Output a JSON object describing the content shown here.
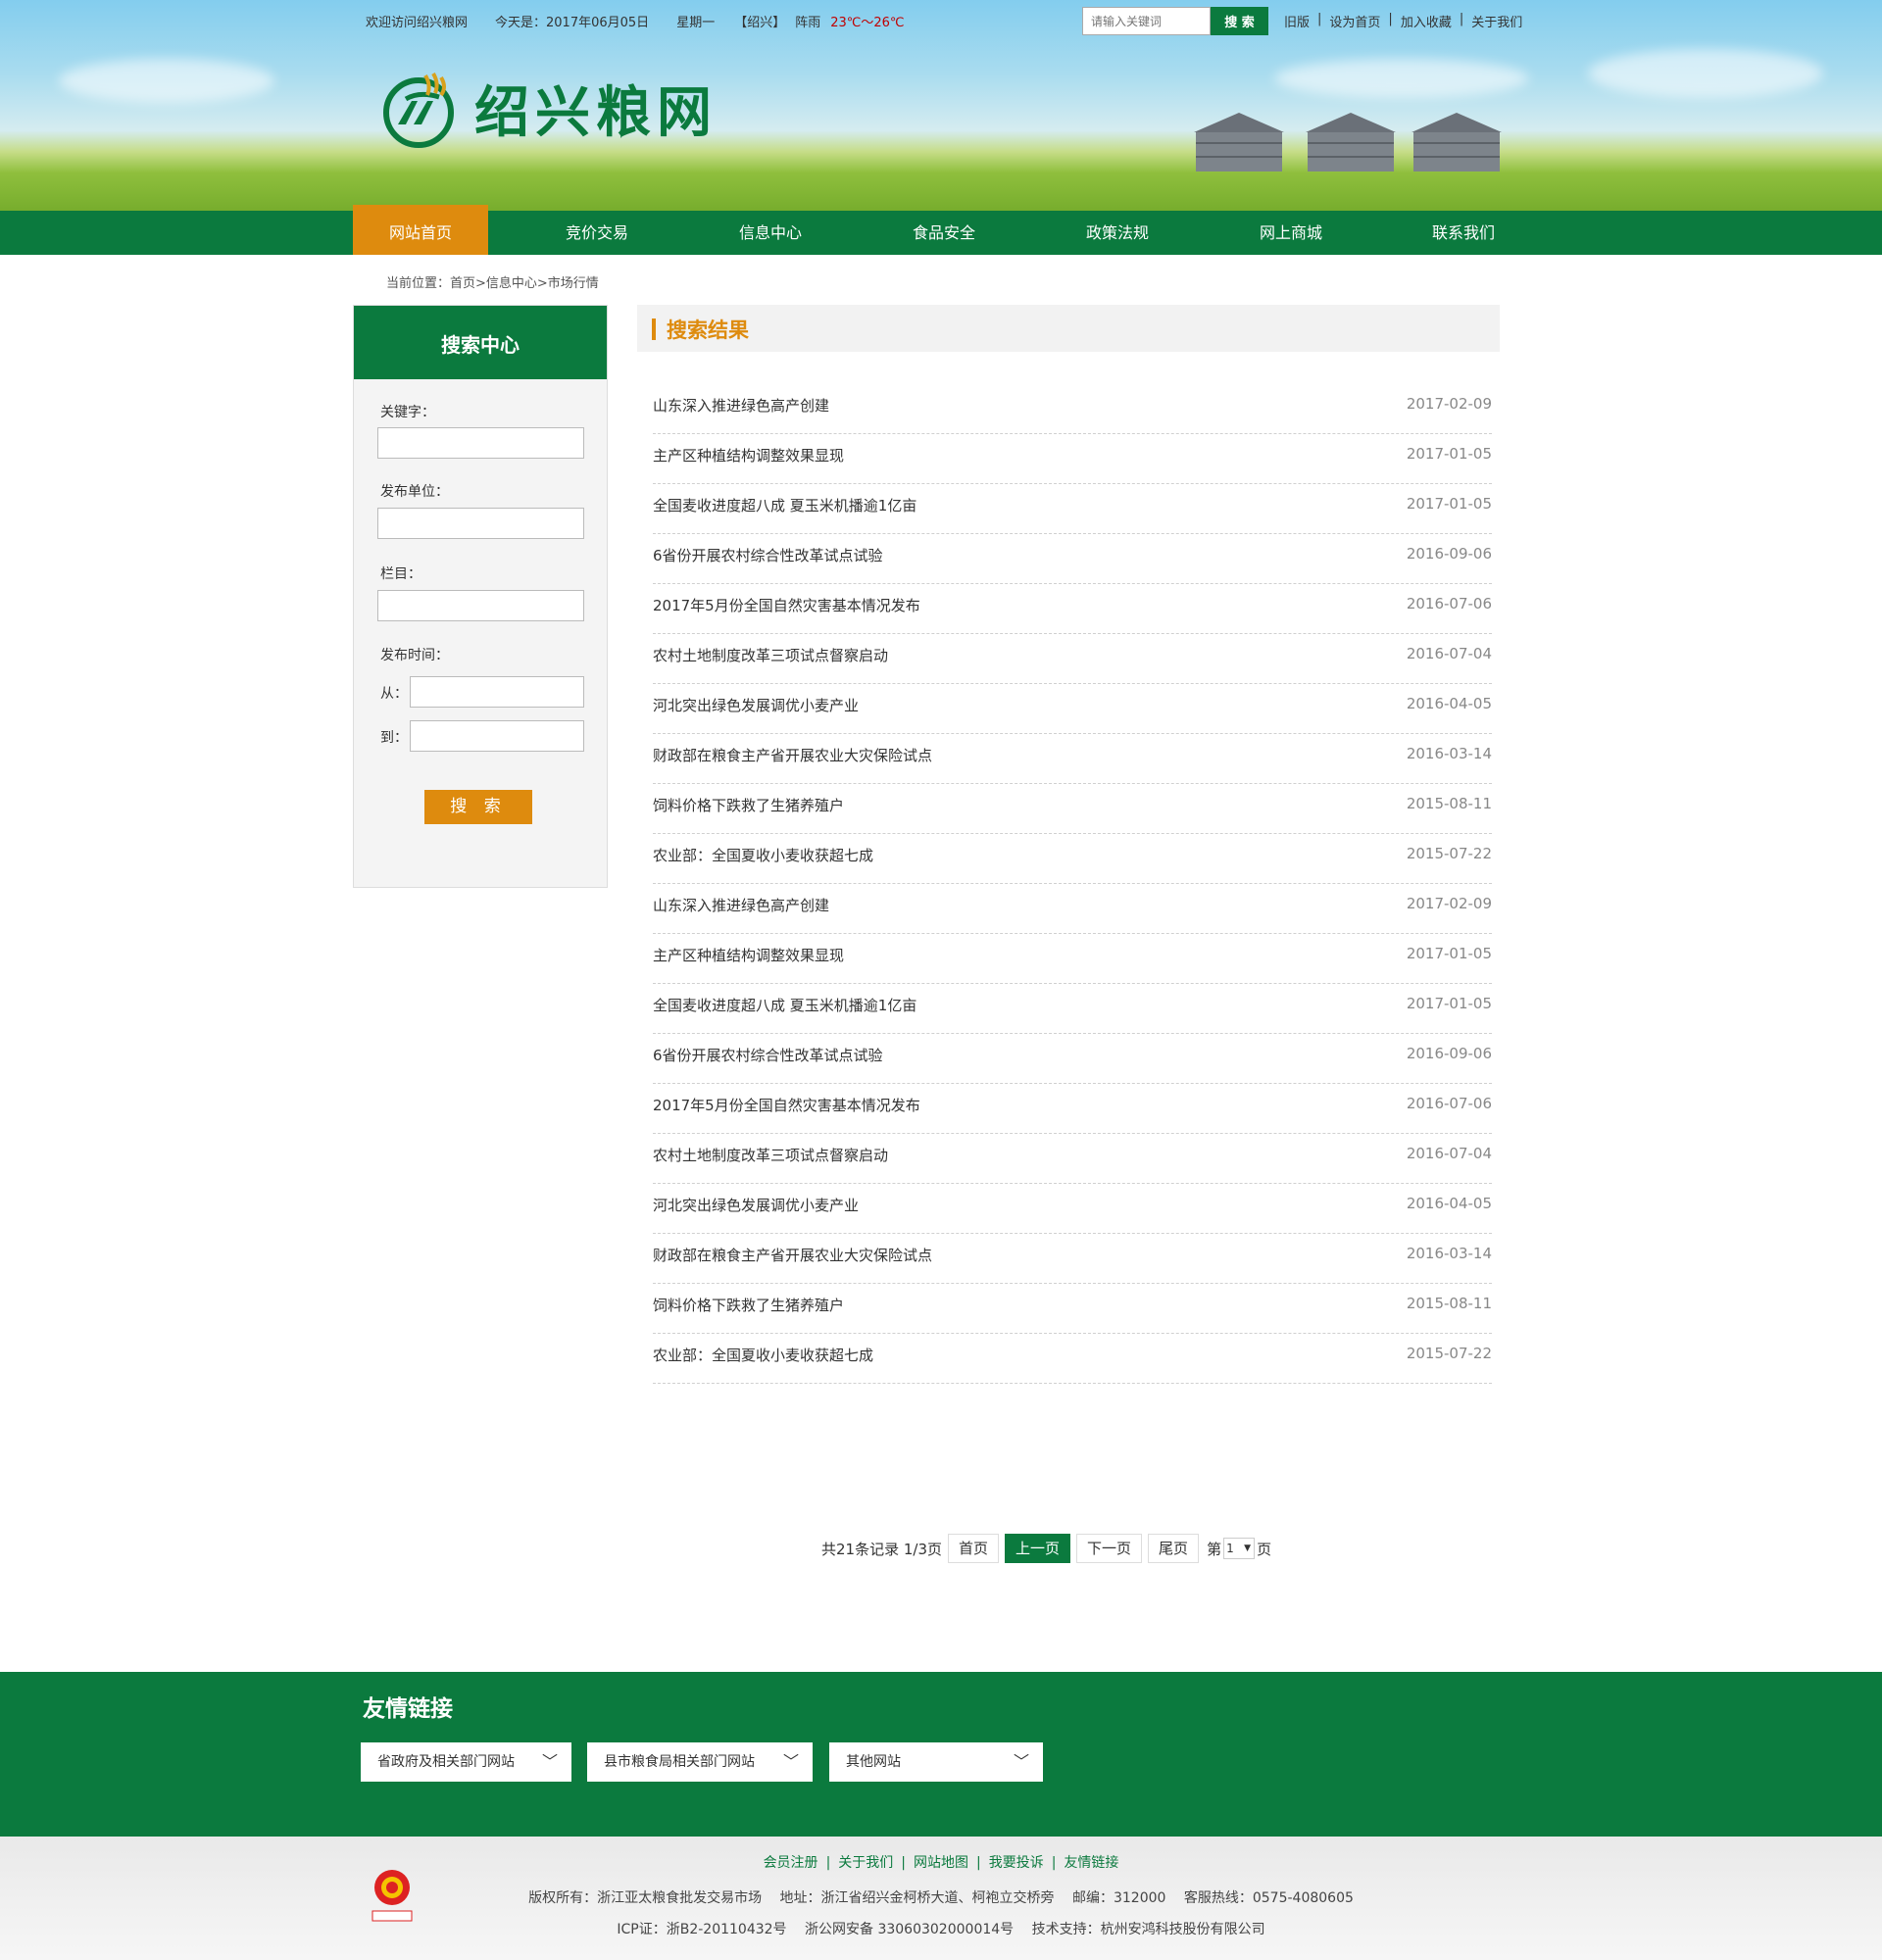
{
  "header": {
    "welcome": "欢迎访问绍兴粮网",
    "today": "今天是：2017年06月05日",
    "weekday": "星期一",
    "city": "【绍兴】",
    "weather": "阵雨",
    "temperature": "23℃～26℃",
    "search_placeholder": "请输入关键词",
    "search_button": "搜 索",
    "links": [
      "旧版",
      "设为首页",
      "加入收藏",
      "关于我们"
    ],
    "site_name": "绍兴粮网"
  },
  "nav": {
    "items": [
      "网站首页",
      "竞价交易",
      "信息中心",
      "食品安全",
      "政策法规",
      "网上商城",
      "联系我们"
    ],
    "active": "网站首页"
  },
  "breadcrumb": "当前位置：首页>信息中心>市场行情",
  "sidebar": {
    "title": "搜索中心",
    "keyword_label": "关键字：",
    "unit_label": "发布单位：",
    "column_label": "栏目：",
    "time_label": "发布时间：",
    "from_label": "从：",
    "to_label": "到：",
    "button": "搜 索"
  },
  "results": {
    "title": "搜索结果",
    "items": [
      {
        "title": "山东深入推进绿色高产创建",
        "date": "2017-02-09"
      },
      {
        "title": "主产区种植结构调整效果显现",
        "date": "2017-01-05"
      },
      {
        "title": "全国麦收进度超八成 夏玉米机播逾1亿亩",
        "date": "2017-01-05"
      },
      {
        "title": "6省份开展农村综合性改革试点试验",
        "date": "2016-09-06"
      },
      {
        "title": "2017年5月份全国自然灾害基本情况发布",
        "date": "2016-07-06"
      },
      {
        "title": "农村土地制度改革三项试点督察启动",
        "date": "2016-07-04"
      },
      {
        "title": "河北突出绿色发展调优小麦产业",
        "date": "2016-04-05"
      },
      {
        "title": "财政部在粮食主产省开展农业大灾保险试点",
        "date": "2016-03-14"
      },
      {
        "title": "饲料价格下跌救了生猪养殖户",
        "date": "2015-08-11"
      },
      {
        "title": "农业部：全国夏收小麦收获超七成",
        "date": "2015-07-22"
      },
      {
        "title": "山东深入推进绿色高产创建",
        "date": "2017-02-09"
      },
      {
        "title": "主产区种植结构调整效果显现",
        "date": "2017-01-05"
      },
      {
        "title": "全国麦收进度超八成 夏玉米机播逾1亿亩",
        "date": "2017-01-05"
      },
      {
        "title": "6省份开展农村综合性改革试点试验",
        "date": "2016-09-06"
      },
      {
        "title": "2017年5月份全国自然灾害基本情况发布",
        "date": "2016-07-06"
      },
      {
        "title": "农村土地制度改革三项试点督察启动",
        "date": "2016-07-04"
      },
      {
        "title": "河北突出绿色发展调优小麦产业",
        "date": "2016-04-05"
      },
      {
        "title": "财政部在粮食主产省开展农业大灾保险试点",
        "date": "2016-03-14"
      },
      {
        "title": "饲料价格下跌救了生猪养殖户",
        "date": "2015-08-11"
      },
      {
        "title": "农业部：全国夏收小麦收获超七成",
        "date": "2015-07-22"
      }
    ]
  },
  "pager": {
    "summary": "共21条记录 1/3页",
    "first": "首页",
    "prev": "上一页",
    "next": "下一页",
    "last": "尾页",
    "page_prefix": "第",
    "page_value": "1",
    "page_suffix": "页"
  },
  "friend_links": {
    "title": "友情链接",
    "dropdowns": [
      "省政府及相关部门网站",
      "县市粮食局相关部门网站",
      "其他网站"
    ]
  },
  "footer": {
    "links": [
      "会员注册",
      "关于我们",
      "网站地图",
      "我要投诉",
      "友情链接"
    ],
    "line1": "版权所有：浙江亚太粮食批发交易市场　 地址：浙江省绍兴金柯桥大道、柯袍立交桥旁　 邮编：312000　 客服热线：0575-4080605",
    "line2": "ICP证：浙B2-20110432号　 浙公网安备 33060302000014号　 技术支持：杭州安鸿科技股份有限公司",
    "emblem_text": "网络工商"
  },
  "colors": {
    "brand_green": "#0b7a3e",
    "accent_orange": "#de8b0e",
    "temp_red": "#c00000"
  }
}
